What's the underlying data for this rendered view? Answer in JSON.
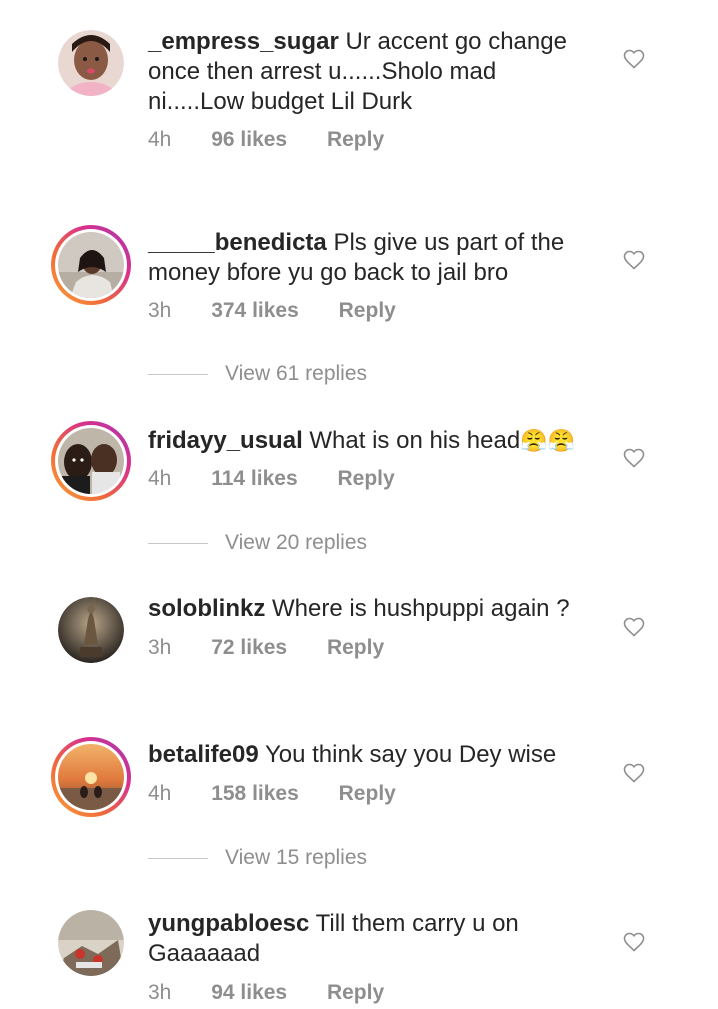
{
  "comments": [
    {
      "username": "_empress_sugar",
      "text_lines": [
        "Ur accent go change",
        "once then arrest u......Sholo mad",
        "ni.....Low budget Lil Durk"
      ],
      "time": "4h",
      "likes": "96 likes",
      "reply": "Reply"
    },
    {
      "username": "_____benedicta",
      "text_lines": [
        "Pls give us part of the",
        "money bfore yu go back to jail bro"
      ],
      "time": "3h",
      "likes": "374 likes",
      "reply": "Reply",
      "view_replies": "View 61 replies"
    },
    {
      "username": "fridayy_usual",
      "text_lines": [
        "What is on his head"
      ],
      "emoji": "😤😤",
      "time": "4h",
      "likes": "114 likes",
      "reply": "Reply",
      "view_replies": "View 20 replies"
    },
    {
      "username": "soloblinkz",
      "text_lines": [
        "Where is hushpuppi again ?"
      ],
      "time": "3h",
      "likes": "72 likes",
      "reply": "Reply"
    },
    {
      "username": "betalife09",
      "text_lines": [
        "You think say you Dey wise"
      ],
      "time": "4h",
      "likes": "158 likes",
      "reply": "Reply",
      "view_replies": "View 15 replies"
    },
    {
      "username": "yungpabloesc",
      "text_lines": [
        "Till them carry u on",
        "Gaaaaaad"
      ],
      "time": "3h",
      "likes": "94 likes",
      "reply": "Reply"
    }
  ],
  "icons": {
    "like": "heart-outline-icon"
  },
  "colors": {
    "text": "#262626",
    "meta": "#8e8e8e",
    "story_ring": "#d7308d"
  }
}
